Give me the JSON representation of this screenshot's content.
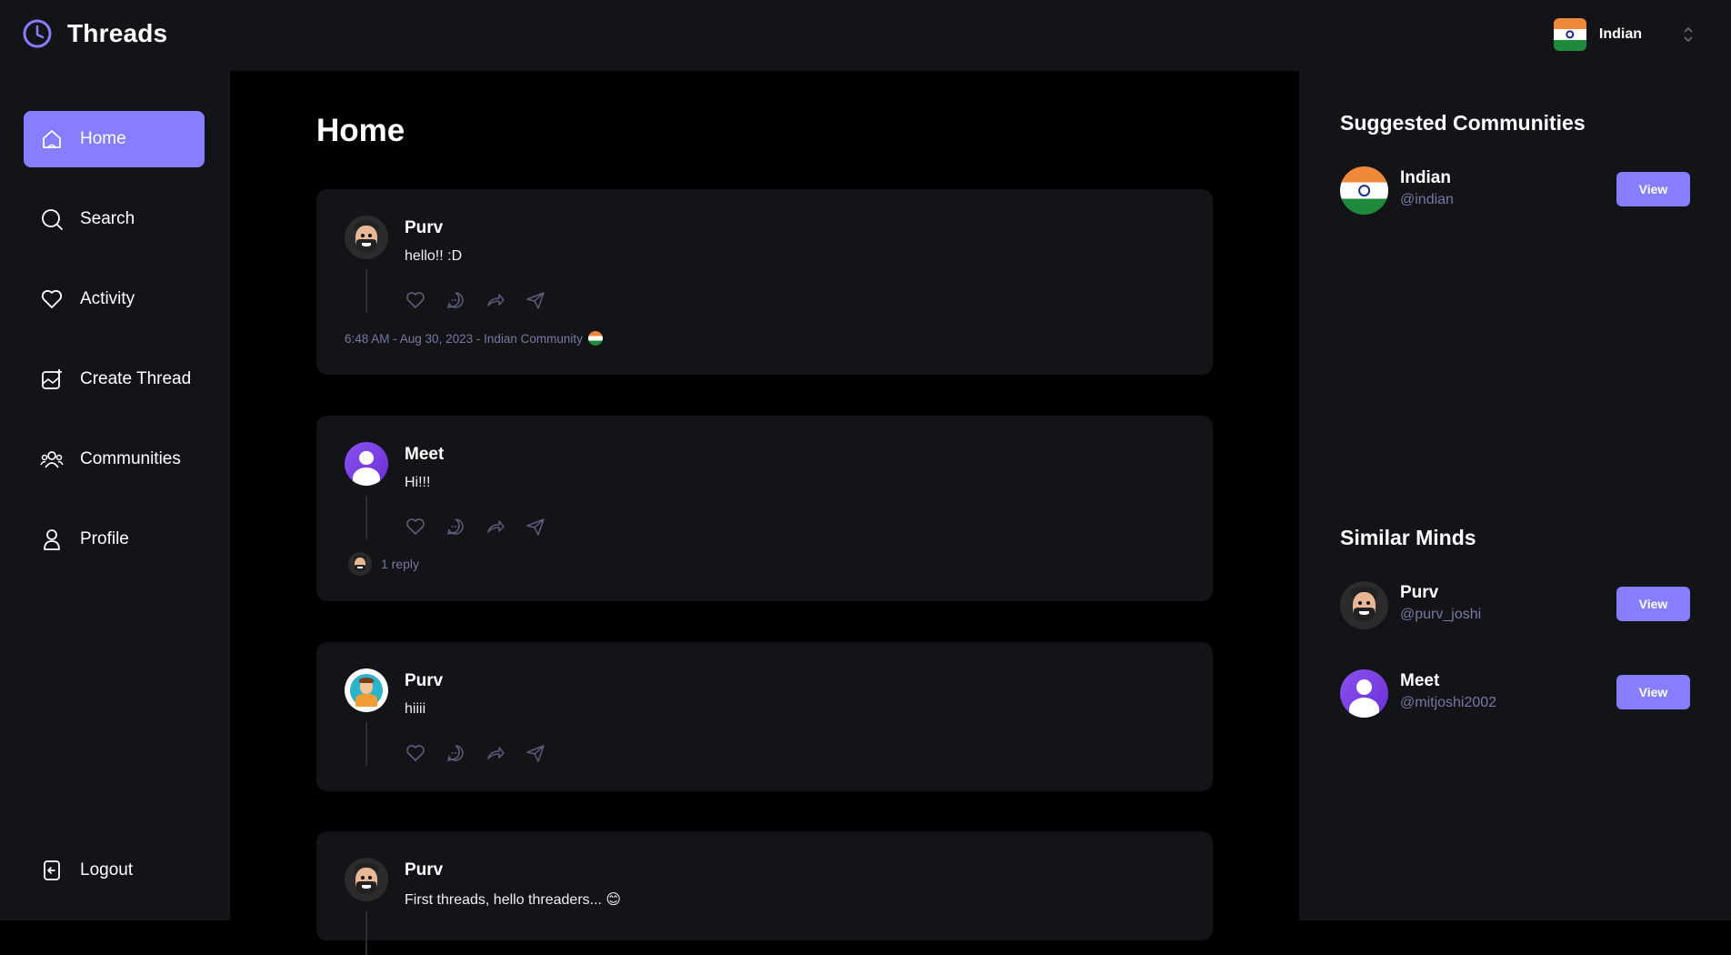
{
  "app": {
    "name": "Threads"
  },
  "org_switcher": {
    "name": "Indian"
  },
  "nav": [
    {
      "label": "Home",
      "icon": "home-icon",
      "active": true
    },
    {
      "label": "Search",
      "icon": "search-icon"
    },
    {
      "label": "Activity",
      "icon": "heart-icon"
    },
    {
      "label": "Create Thread",
      "icon": "create-thread-icon"
    },
    {
      "label": "Communities",
      "icon": "communities-icon"
    },
    {
      "label": "Profile",
      "icon": "profile-icon"
    }
  ],
  "logout": {
    "label": "Logout",
    "icon": "logout-icon"
  },
  "main": {
    "title": "Home",
    "threads": [
      {
        "author": "Purv",
        "text": "hello!! :D",
        "meta": "6:48 AM - Aug 30, 2023 - Indian Community"
      },
      {
        "author": "Meet",
        "text": "Hi!!!",
        "replies": "1 reply"
      },
      {
        "author": "Purv",
        "text": "hiiii"
      },
      {
        "author": "Purv",
        "text": "First threads, hello threaders... 😊"
      }
    ]
  },
  "right": {
    "suggested_title": "Suggested Communities",
    "communities": [
      {
        "name": "Indian",
        "handle": "@indian",
        "button": "View"
      }
    ],
    "similar_title": "Similar Minds",
    "users": [
      {
        "name": "Purv",
        "handle": "@purv_joshi",
        "button": "View"
      },
      {
        "name": "Meet",
        "handle": "@mitjoshi2002",
        "button": "View"
      }
    ]
  },
  "colors": {
    "accent": "#877eff",
    "panel": "#121417",
    "muted": "#7878a3",
    "background": "#000000"
  }
}
